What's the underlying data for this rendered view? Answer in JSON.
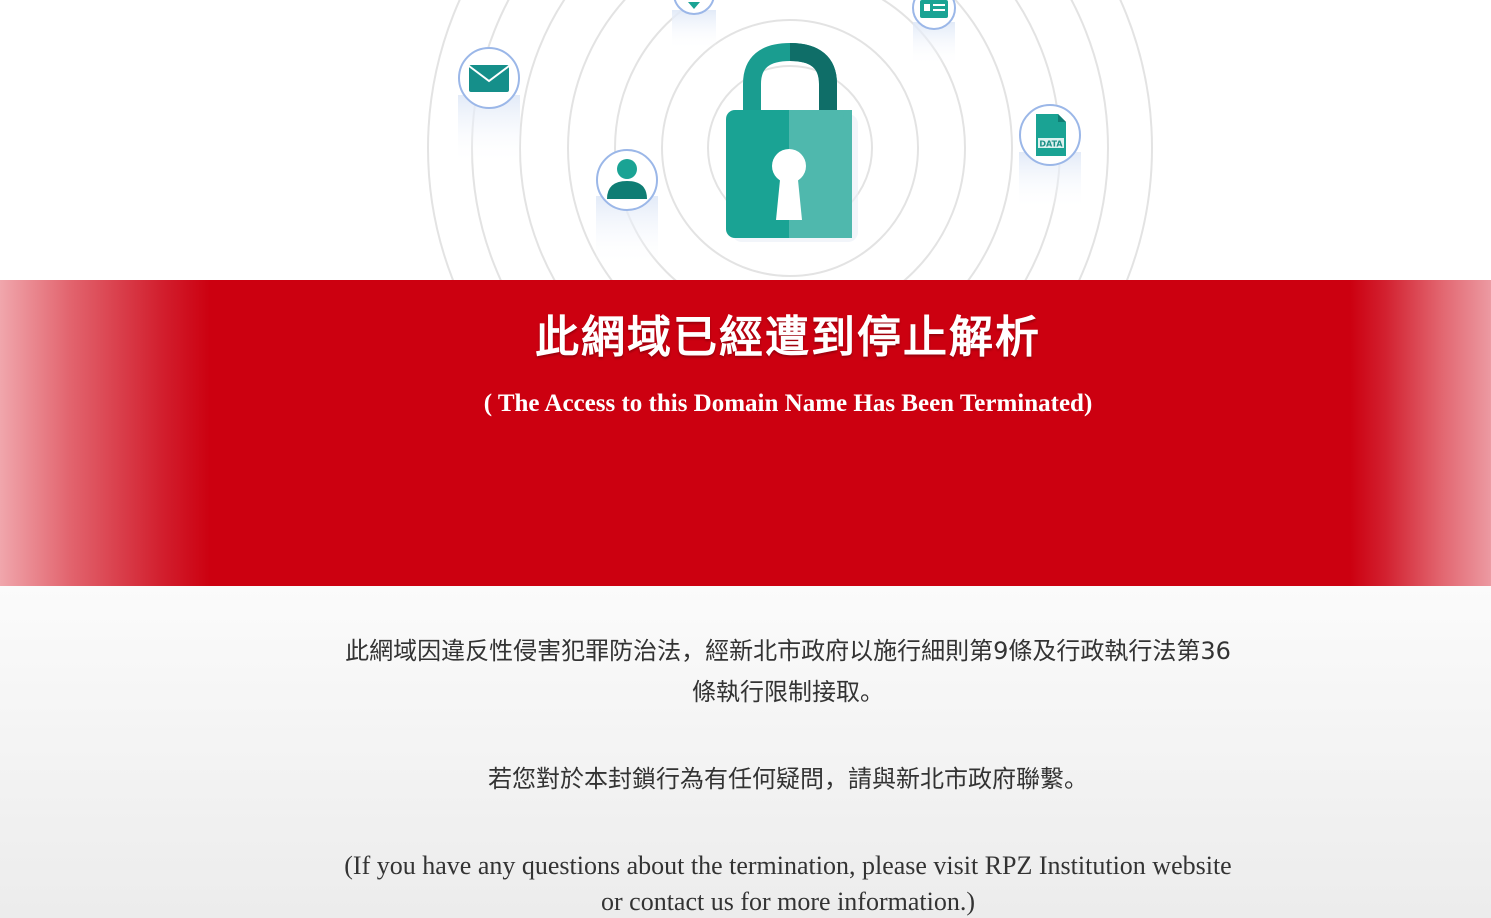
{
  "hero": {
    "icons": [
      "padlock-icon",
      "envelope-icon",
      "user-icon",
      "id-card-icon",
      "data-file-icon",
      "map-pin-icon"
    ],
    "data_icon_label": "DATA",
    "colors": {
      "teal": "#1aa394",
      "teal_dark": "#0f7d74",
      "ring": "#e3e3e3",
      "icon_border": "#9bb7e8"
    }
  },
  "banner": {
    "title": "此網域已經遭到停止解析",
    "subtitle": "( The Access to this Domain Name Has Been Terminated)",
    "color": "#cc0010"
  },
  "message": {
    "paragraph_1": "此網域因違反性侵害犯罪防治法，經新北市政府以施行細則第9條及行政執行法第36條執行限制接取。",
    "paragraph_2": "若您對於本封鎖行為有任何疑問，請與新北市政府聯繫。",
    "paragraph_en": "(If you have any questions about the termination, please visit RPZ Institution website or contact us for more information.)"
  }
}
